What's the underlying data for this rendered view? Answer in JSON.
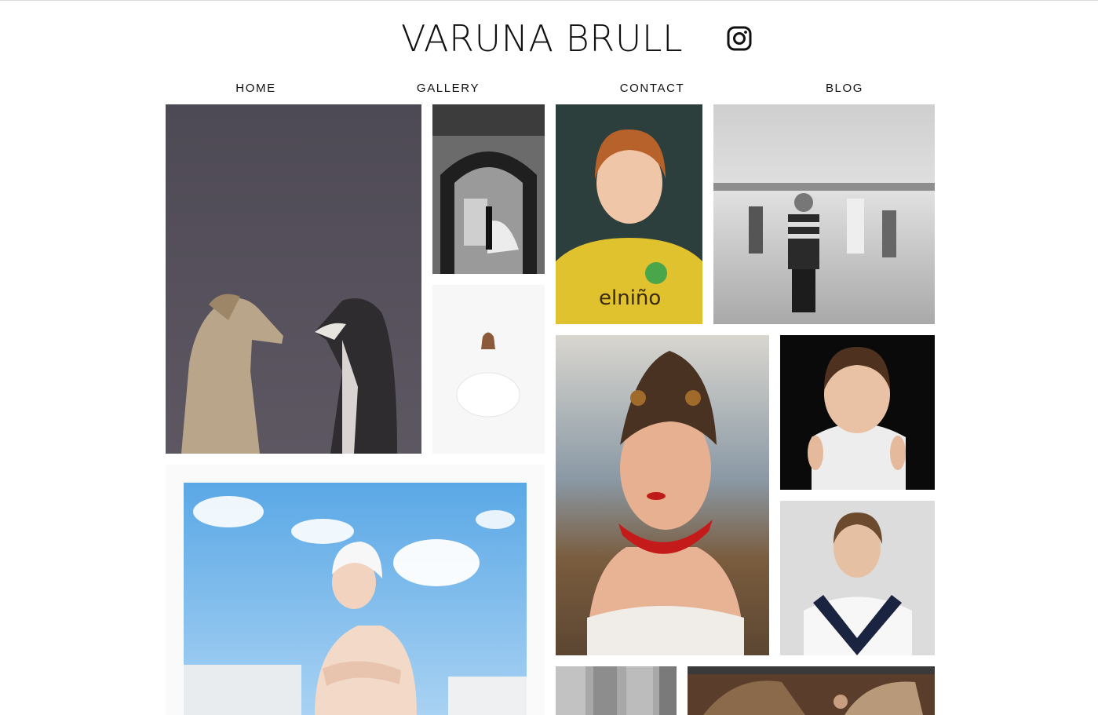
{
  "header": {
    "site_title": "VARUNA BRULL",
    "social_icon": "instagram-icon"
  },
  "nav": {
    "items": [
      {
        "label": "HOME"
      },
      {
        "label": "GALLERY"
      },
      {
        "label": "CONTACT"
      },
      {
        "label": "BLOG"
      }
    ]
  },
  "gallery": {
    "photos": [
      {
        "subject": "two greyhounds facing each other"
      },
      {
        "subject": "couple under stone archway, black and white"
      },
      {
        "subject": "girl sitting in white dress on white background"
      },
      {
        "subject": "red-haired boy in yellow t-shirt"
      },
      {
        "subject": "children playing on beach, black and white"
      },
      {
        "subject": "woman with ornate mask and red chili necklace"
      },
      {
        "subject": "girl holding white collar on black background"
      },
      {
        "subject": "boy in sailor suit"
      },
      {
        "subject": "woman in white swim cap under blue sky"
      },
      {
        "subject": "stone wall, black and white"
      },
      {
        "subject": "girl among old ruins"
      }
    ]
  },
  "colors": {
    "text": "#111111",
    "background": "#ffffff",
    "divider": "#d9d9d9"
  }
}
